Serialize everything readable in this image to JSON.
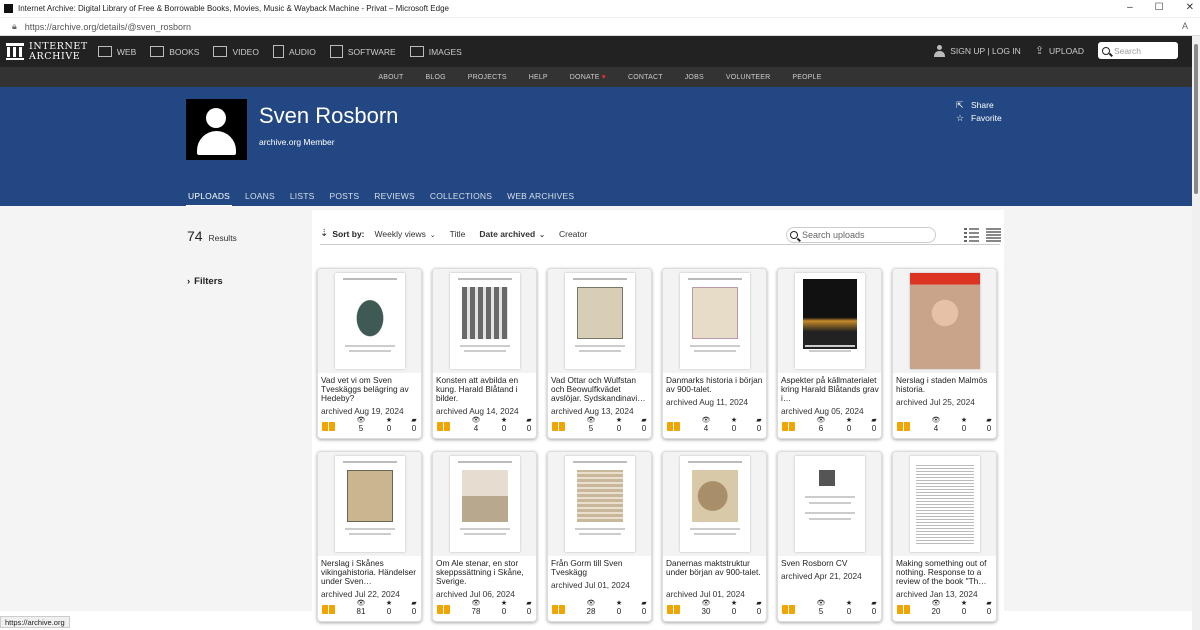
{
  "window": {
    "title": "Internet Archive: Digital Library of Free & Borrowable Books, Movies, Music & Wayback Machine - Privat – Microsoft Edge",
    "url": "https://archive.org/details/@sven_rosborn"
  },
  "ia_nav": {
    "logo_line1": "INTERNET",
    "logo_line2": "ARCHIVE",
    "media": [
      "WEB",
      "BOOKS",
      "VIDEO",
      "AUDIO",
      "SOFTWARE",
      "IMAGES"
    ],
    "signup": "SIGN UP | LOG IN",
    "upload": "UPLOAD",
    "search_placeholder": "Search"
  },
  "subnav": [
    "ABOUT",
    "BLOG",
    "PROJECTS",
    "HELP",
    "DONATE",
    "CONTACT",
    "JOBS",
    "VOLUNTEER",
    "PEOPLE"
  ],
  "profile": {
    "name": "Sven Rosborn",
    "subtitle": "archive.org Member",
    "share": "Share",
    "favorite": "Favorite",
    "tabs": [
      "UPLOADS",
      "LOANS",
      "LISTS",
      "POSTS",
      "REVIEWS",
      "COLLECTIONS",
      "WEB ARCHIVES"
    ]
  },
  "sidebar": {
    "results_count": "74",
    "results_label": "Results",
    "filters_label": "Filters"
  },
  "sortbar": {
    "label": "Sort by:",
    "options": [
      "Weekly views",
      "Title",
      "Date archived",
      "Creator"
    ],
    "search_placeholder": "Search uploads"
  },
  "items": [
    {
      "title": "Vad vet vi om Sven Tveskäggs belägring av Hedeby?",
      "date": "archived Aug 19, 2024",
      "views": "5",
      "favs": "0",
      "reviews": "0"
    },
    {
      "title": "Konsten att avbilda en kung. Harald Blåtand i bilder.",
      "date": "archived Aug 14, 2024",
      "views": "4",
      "favs": "0",
      "reviews": "0"
    },
    {
      "title": "Vad Ottar och Wulfstan och Beowulfkvädet avslöjar. Sydskandinavi…",
      "date": "archived Aug 13, 2024",
      "views": "5",
      "favs": "0",
      "reviews": "0"
    },
    {
      "title": "Danmarks historia i början av 900-talet.",
      "date": "archived Aug 11, 2024",
      "views": "4",
      "favs": "0",
      "reviews": "0"
    },
    {
      "title": "Aspekter på källmaterialet kring Harald Blåtands grav i…",
      "date": "archived Aug 05, 2024",
      "views": "6",
      "favs": "0",
      "reviews": "0"
    },
    {
      "title": "Nerslag i staden Malmös historia.",
      "date": "archived Jul 25, 2024",
      "views": "4",
      "favs": "0",
      "reviews": "0"
    },
    {
      "title": "Nerslag i Skånes vikingahistoria. Händelser under Sven…",
      "date": "archived Jul 22, 2024",
      "views": "81",
      "favs": "0",
      "reviews": "0"
    },
    {
      "title": "Om Ale stenar, en stor skeppssättning i Skåne, Sverige.",
      "date": "archived Jul 06, 2024",
      "views": "78",
      "favs": "0",
      "reviews": "0"
    },
    {
      "title": "Från Gorm till Sven Tveskägg",
      "date": "archived Jul 01, 2024",
      "views": "28",
      "favs": "0",
      "reviews": "0"
    },
    {
      "title": "Danernas maktstruktur under början av 900-talet.",
      "date": "archived Jul 01, 2024",
      "views": "30",
      "favs": "0",
      "reviews": "0"
    },
    {
      "title": "Sven Rosborn CV",
      "date": "archived Apr 21, 2024",
      "views": "5",
      "favs": "0",
      "reviews": "0"
    },
    {
      "title": "Making something out of nothing. Response to a review of the book \"Th…",
      "date": "archived Jan 13, 2024",
      "views": "20",
      "favs": "0",
      "reviews": "0"
    }
  ],
  "statusbar": "https://archive.org",
  "colors": {
    "banner": "#224782",
    "nav": "#222222",
    "subnav": "#333333",
    "book": "#f0a500"
  }
}
